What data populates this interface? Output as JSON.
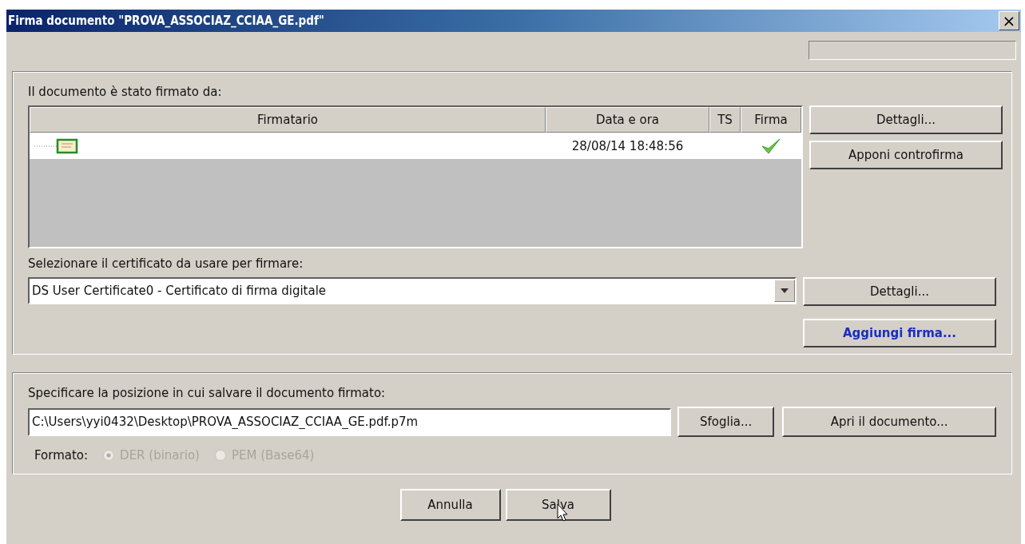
{
  "window": {
    "title": "Firma documento \"PROVA_ASSOCIAZ_CCIAA_GE.pdf\"",
    "close": "×"
  },
  "signers": {
    "label": "Il documento è stato firmato da:",
    "columns": [
      "Firmatario",
      "Data e ora",
      "TS",
      "Firma"
    ],
    "rows": [
      {
        "date": "28/08/14 18:48:56",
        "signature_valid": true
      }
    ],
    "buttons": [
      "Dettagli...",
      "Apponi controfirma"
    ]
  },
  "certificate": {
    "label": "Selezionare il certificato da usare per firmare:",
    "value": "DS User Certificate0 - Certificato di firma digitale",
    "buttons": [
      {
        "label": "Dettagli...",
        "kind": "normal"
      },
      {
        "label": "Aggiungi firma...",
        "kind": "emphasized"
      }
    ]
  },
  "output": {
    "label": "Specificare la posizione in cui salvare il documento firmato:",
    "path": "C:\\Users\\yyi0432\\Desktop\\PROVA_ASSOCIAZ_CCIAA_GE.pdf.p7m",
    "buttons": [
      "Sfoglia...",
      "Apri il documento..."
    ],
    "format_label": "Formato:",
    "formats": [
      {
        "label": "DER (binario)",
        "selected": true,
        "disabled": true
      },
      {
        "label": "PEM (Base64)",
        "selected": false,
        "disabled": true
      }
    ]
  },
  "footer": {
    "buttons": [
      {
        "label": "Annulla",
        "hovered": false
      },
      {
        "label": "Salva",
        "hovered": true
      }
    ]
  }
}
